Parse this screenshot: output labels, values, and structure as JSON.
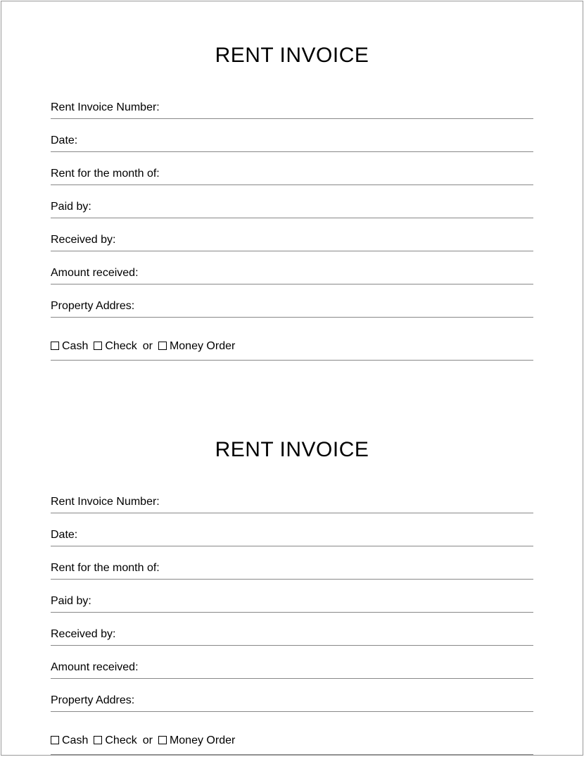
{
  "invoice1": {
    "title": "RENT INVOICE",
    "fields": {
      "invoice_number": "Rent Invoice Number:",
      "date": "Date:",
      "month": "Rent for the month of:",
      "paid_by": "Paid by:",
      "received_by": "Received by:",
      "amount": "Amount received:",
      "address": "Property Addres:"
    },
    "payment": {
      "cash": "Cash",
      "check": "Check",
      "or": "or",
      "money_order": "Money Order"
    }
  },
  "invoice2": {
    "title": "RENT INVOICE",
    "fields": {
      "invoice_number": "Rent Invoice Number:",
      "date": "Date:",
      "month": "Rent for the month of:",
      "paid_by": "Paid by:",
      "received_by": "Received by:",
      "amount": "Amount received:",
      "address": "Property Addres:"
    },
    "payment": {
      "cash": "Cash",
      "check": "Check",
      "or": "or",
      "money_order": "Money Order"
    }
  }
}
